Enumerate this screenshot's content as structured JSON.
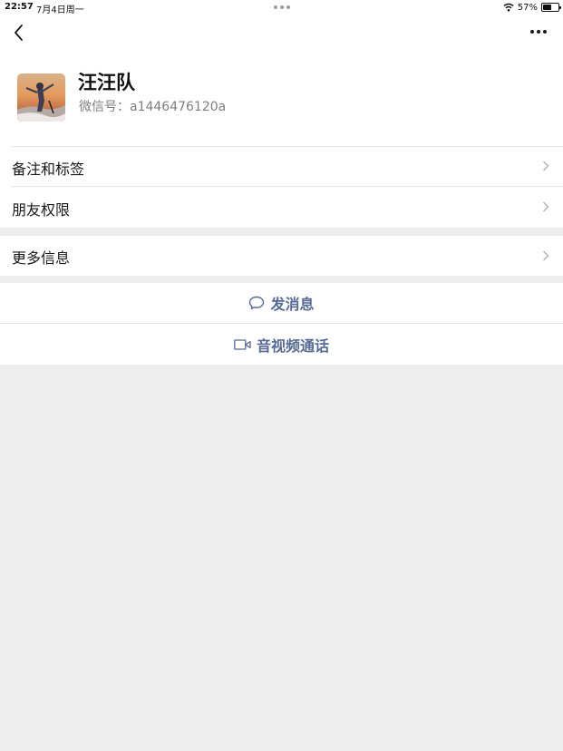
{
  "status_bar": {
    "time": "22:57",
    "date": "7月4日周一",
    "battery_percent": "57%",
    "battery_level": 0.57
  },
  "profile": {
    "name": "汪汪队",
    "wechat_id": "微信号：a1446476120a"
  },
  "menu": {
    "remark_tags": "备注和标签",
    "friend_permissions": "朋友权限",
    "more_info": "更多信息"
  },
  "actions": {
    "send_message": "发消息",
    "video_call": "音视频通话"
  },
  "colors": {
    "link_blue": "#576b95",
    "background_gray": "#ededed",
    "separator": "#e5e5e5"
  },
  "icons": [
    "back-arrow-icon",
    "more-dots-icon",
    "wifi-icon",
    "battery-icon",
    "chevron-right-icon",
    "chat-bubble-icon",
    "video-camera-icon"
  ]
}
